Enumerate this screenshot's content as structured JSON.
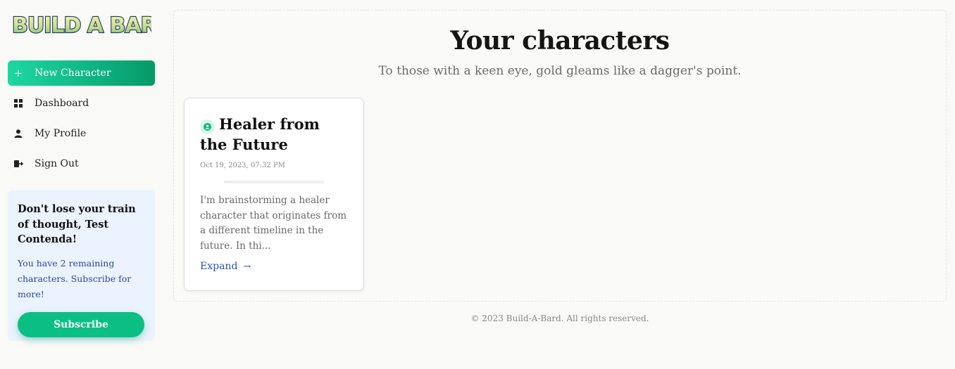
{
  "logo": {
    "text": "BUILD A BARD"
  },
  "nav": {
    "new_character": "New Character",
    "dashboard": "Dashboard",
    "my_profile": "My Profile",
    "sign_out": "Sign Out"
  },
  "promo": {
    "title": "Don't lose your train of thought, Test Contenda!",
    "text": "You have 2 remaining characters. Subscribe for more!",
    "button": "Subscribe"
  },
  "main": {
    "title": "Your characters",
    "subtitle": "To those with a keen eye, gold gleams like a dagger's point."
  },
  "cards": [
    {
      "title": "Healer from the Future",
      "date": "Oct 19, 2023, 07:32 PM",
      "excerpt": "I'm brainstorming a healer character that originates from a different timeline in the future. In thi...",
      "expand": "Expand"
    }
  ],
  "footer": {
    "text": "© 2023 Build-A-Bard. All rights reserved."
  },
  "colors": {
    "accent": "#0bbf84",
    "link": "#2b4fb8",
    "promo_bg": "#eaf3fe"
  }
}
